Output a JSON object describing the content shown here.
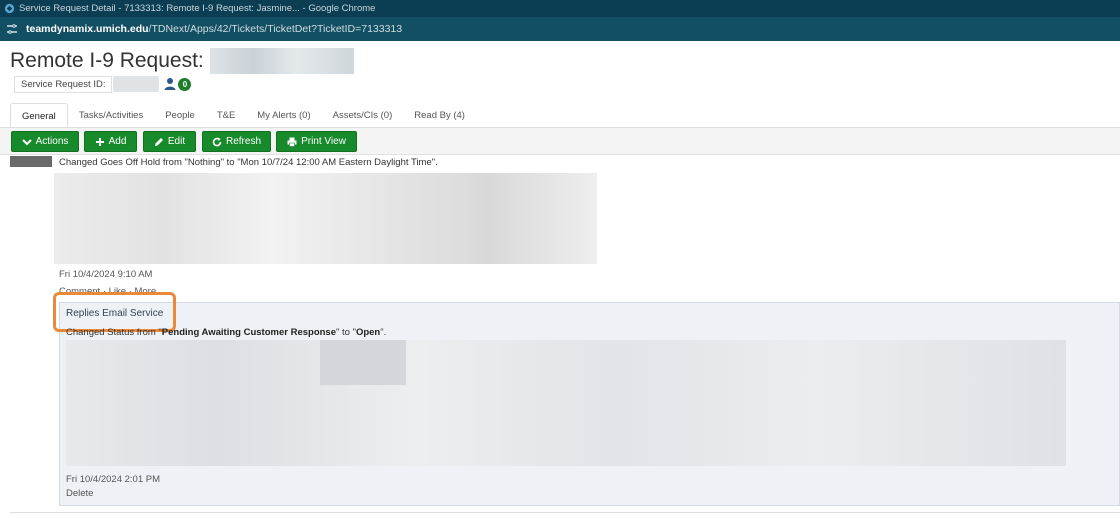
{
  "window": {
    "title": "Service Request Detail - 7133313: Remote I-9 Request: Jasmine... - Google Chrome",
    "url_host": "teamdynamix.umich.edu",
    "url_path": "/TDNext/Apps/42/Tickets/TicketDet?TicketID=7133313"
  },
  "header": {
    "title": "Remote I-9 Request:",
    "id_label": "Service Request ID:",
    "contacts_count": "0"
  },
  "tabs": [
    {
      "label": "General",
      "active": true
    },
    {
      "label": "Tasks/Activities"
    },
    {
      "label": "People"
    },
    {
      "label": "T&E"
    },
    {
      "label": "My Alerts (0)"
    },
    {
      "label": "Assets/CIs (0)"
    },
    {
      "label": "Read By (4)"
    }
  ],
  "toolbar": {
    "actions": "Actions",
    "add": "Add",
    "edit": "Edit",
    "refresh": "Refresh",
    "print": "Print View"
  },
  "feed": {
    "entry1": {
      "text": "Changed Goes Off Hold from \"Nothing\" to \"Mon 10/7/24 12:00 AM Eastern Daylight Time\".",
      "timestamp": "Fri 10/4/2024 9:10 AM",
      "links": "Comment · Like · More"
    },
    "reply": {
      "header": "Replies Email Service",
      "status_prefix": "Changed Status from \"",
      "status_from": "Pending Awaiting Customer Response",
      "status_mid": "\" to \"",
      "status_to": "Open",
      "status_suffix": "\".",
      "timestamp": "Fri 10/4/2024 2:01 PM",
      "delete": "Delete"
    }
  },
  "colors": {
    "titlebar": "#0b3e52",
    "addressbar": "#124f63",
    "button_green": "#178a2c",
    "highlight": "#e98a3b"
  }
}
